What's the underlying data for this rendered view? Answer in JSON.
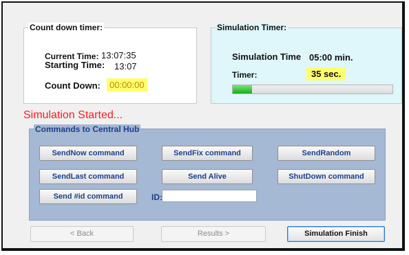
{
  "countdown": {
    "title": "Count down timer:",
    "current_time_label": "Current Time:",
    "current_time_value": "13:07:35",
    "starting_time_label": "Starting Time:",
    "starting_time_value": "13:07",
    "countdown_label": "Count Down:",
    "countdown_value": "00:00:00"
  },
  "sim_timer": {
    "title": "Simulation Timer:",
    "sim_time_label": "Simulation Time",
    "sim_time_value": "05:00 min.",
    "timer_label": "Timer:",
    "timer_value": "35 sec.",
    "progress_fraction": 0.12
  },
  "status": {
    "text": "Simulation Started..."
  },
  "commands": {
    "title": "Commands to Central Hub",
    "send_now": "SendNow command",
    "send_fix": "SendFix command",
    "send_random": "SendRandom",
    "send_last": "SendLast command",
    "send_alive": "Send Alive",
    "shutdown": "ShutDown command",
    "send_id": "Send #id command",
    "id_label": "ID:",
    "id_value": ""
  },
  "nav": {
    "back": "< Back",
    "results": "Results >",
    "finish": "Simulation Finish"
  },
  "colors": {
    "status_text": "#ff1a1a",
    "sim_panel_bg": "#dff6fa",
    "commands_bg": "#a5b8d4",
    "highlight": "#ffff6e",
    "progress_fill": "#10b010"
  }
}
